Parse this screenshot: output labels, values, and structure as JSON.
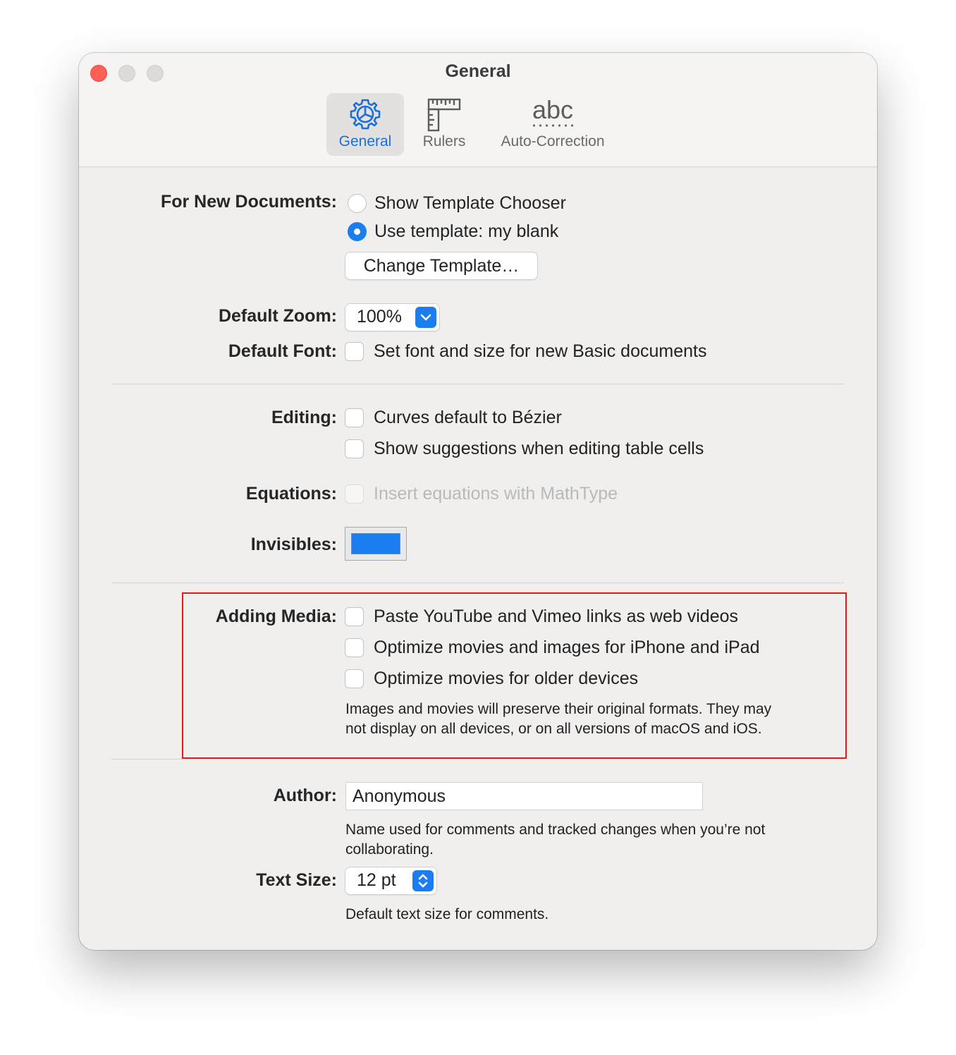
{
  "window": {
    "title": "General",
    "tabs": [
      {
        "label": "General",
        "icon": "gear-icon",
        "active": true
      },
      {
        "label": "Rulers",
        "icon": "ruler-icon",
        "active": false
      },
      {
        "label": "Auto-Correction",
        "icon": "abc-icon",
        "icon_text": "abc",
        "active": false
      }
    ]
  },
  "new_documents": {
    "label": "For New Documents:",
    "options": [
      {
        "label": "Show Template Chooser",
        "selected": false
      },
      {
        "label": "Use template: my blank",
        "selected": true
      }
    ],
    "button": "Change Template…"
  },
  "default_zoom": {
    "label": "Default Zoom:",
    "value": "100%"
  },
  "default_font": {
    "label": "Default Font:",
    "option": "Set font and size for new Basic documents",
    "checked": false
  },
  "editing": {
    "label": "Editing:",
    "options": [
      {
        "label": "Curves default to Bézier",
        "checked": false
      },
      {
        "label": "Show suggestions when editing table cells",
        "checked": false
      }
    ]
  },
  "equations": {
    "label": "Equations:",
    "option": "Insert equations with MathType",
    "checked": false,
    "enabled": false
  },
  "invisibles": {
    "label": "Invisibles:",
    "color": "#1a7ef0"
  },
  "adding_media": {
    "label": "Adding Media:",
    "options": [
      {
        "label": "Paste YouTube and Vimeo links as web videos",
        "checked": false
      },
      {
        "label": "Optimize movies and images for iPhone and iPad",
        "checked": false
      },
      {
        "label": "Optimize movies for older devices",
        "checked": false
      }
    ],
    "note_line1": "Images and movies will preserve their original formats. They may",
    "note_line2": "not display on all devices, or on all versions of macOS and iOS."
  },
  "author": {
    "label": "Author:",
    "value": "Anonymous",
    "note_line1": "Name used for comments and tracked changes when you’re not",
    "note_line2": "collaborating."
  },
  "text_size": {
    "label": "Text Size:",
    "value": "12 pt",
    "note": "Default text size for comments."
  },
  "colors": {
    "accent": "#1a7ef0",
    "highlight_border": "#e01b1b",
    "close_button": "#fe5f57"
  }
}
